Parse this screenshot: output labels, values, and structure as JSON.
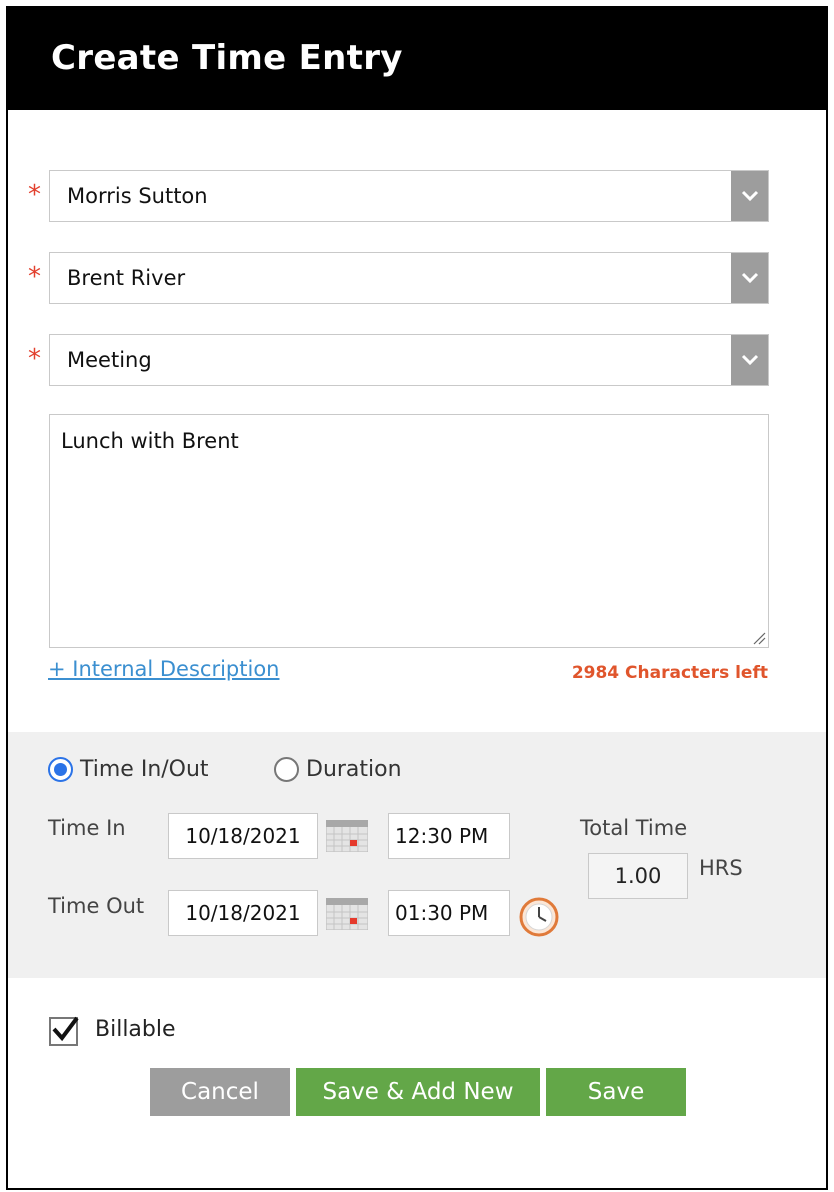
{
  "dialog": {
    "title": "Create Time Entry"
  },
  "fields": {
    "required_marker": "*",
    "employee": {
      "value": "Morris Sutton"
    },
    "client": {
      "value": "Brent River"
    },
    "activity": {
      "value": "Meeting"
    },
    "description": {
      "value": "Lunch with Brent"
    },
    "internal_description_link": "+ Internal Description",
    "chars_left": "2984 Characters left"
  },
  "time": {
    "mode_time_in_out": "Time In/Out",
    "mode_duration": "Duration",
    "selected_mode": "Time In/Out",
    "time_in_label": "Time In",
    "time_out_label": "Time Out",
    "time_in_date": "10/18/2021",
    "time_in_time": "12:30 PM",
    "time_out_date": "10/18/2021",
    "time_out_time": "01:30 PM",
    "total_time_label": "Total Time",
    "total_time_value": "1.00",
    "total_time_unit": "HRS"
  },
  "billable": {
    "label": "Billable",
    "checked": true
  },
  "buttons": {
    "cancel": "Cancel",
    "save_add_new": "Save & Add New",
    "save": "Save"
  },
  "colors": {
    "header_bg": "#000000",
    "required": "#e2402e",
    "link": "#3b8fd0",
    "chars_left": "#e0552c",
    "radio_selected": "#2b73e7",
    "button_green": "#63a748",
    "button_gray": "#9d9d9d",
    "panel_bg": "#f0f0f0"
  },
  "icons": {
    "dropdown": "chevron-down-icon",
    "calendar": "calendar-icon",
    "clock": "clock-icon",
    "checkmark": "checkmark-icon"
  }
}
